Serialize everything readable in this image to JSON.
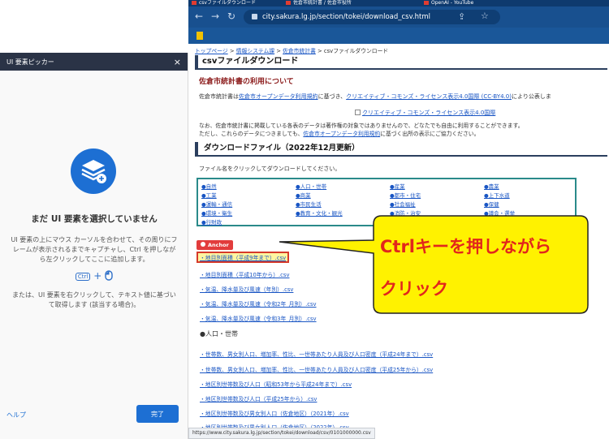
{
  "picker": {
    "title": "UI 要素ピッカー",
    "close": "×",
    "heading": "まだ UI 要素を選択していません",
    "description": "UI 要素の上にマウス カーソルを合わせて、その周りにフレームが表示されるまでキャプチャし、Ctrl を押しながら左クリックしてここに追加します。",
    "ctrl_key": "Ctrl",
    "plus": "+",
    "alt_description": "または、UI 要素を右クリックして、テキスト値に基づいて取得します (該当する場合)。",
    "help_label": "ヘルプ",
    "done_label": "完了"
  },
  "browser": {
    "tabs": [
      "csvファイルダウンロード",
      "佐倉市統計書 / 佐倉市役所",
      "OpenAI - YouTube"
    ],
    "url": "city.sakura.lg.jp/section/tokei/download_csv.html",
    "status_url": "https://www.city.sakura.lg.jp/section/tokei/download/csv/0101000000.csv"
  },
  "page": {
    "breadcrumb": [
      "トップページ",
      "情報システム課",
      "佐倉市統計書",
      "csvファイルダウンロード"
    ],
    "title": "csvファイルダウンロード",
    "section1_heading": "佐倉市統計書の利用について",
    "p1_prefix": "佐倉市統計書は",
    "p1_link": "佐倉市オープンデータ利用規約",
    "p1_mid": "に基づき、",
    "p1_link2": "クリエイティブ・コモンズ・ライセンス表示4.0国際 (CC-BY4.0)",
    "p1_suffix": "により公表しま",
    "cc_link": "クリエイティブ・コモンズ・ライセンス表示4.0国際",
    "p3_line1": "なお、佐倉市統計書に掲載している各表のデータは著作権の対象ではありませんので、どなたでも自由に利用することができます。",
    "p3_line2_prefix": "ただし、これらのデータにつきましても、",
    "p3_line2_link": "佐倉市オープンデータ利用規約",
    "p3_line2_suffix": "に基づく出所の表示にご協力ください。",
    "section2_heading": "ダウンロードファイル（2022年12月更新）",
    "p4": "ファイル名をクリックしてダウンロードしてください。",
    "categories": [
      "●自然",
      "●人口・世帯",
      "●産業",
      "●農業",
      "●工業",
      "●商業",
      "●都市・住宅",
      "●上下水道",
      "●運輸・通信",
      "●市民生活",
      "●社会福祉",
      "●保健",
      "●環境・衛生",
      "●教育・文化・観光",
      "●消防・治安",
      "●議会・選挙",
      "●行財政"
    ],
    "anchor_label": "Anchor",
    "files": [
      "・地目別面積（平成9年まで）.csv",
      "・地目別面積（平成10年から）.csv",
      "・気温、降水量及び風速（年別）.csv",
      "・気温、降水量及び風速（令和2年_月別）.csv",
      "・気温、降水量及び風速（令和3年_月別）.csv"
    ],
    "population_heading": "●人口・世帯",
    "pop_files": [
      "・世帯数、男女別人口、増加率、性比、一世帯あたり人員及び人口密度（平成24年まで）.csv",
      "・世帯数、男女別人口、増加率、性比、一世帯あたり人員及び人口密度（平成25年から）.csv",
      "・地区別世帯数及び人口（昭和53年から平成24年まで）.csv",
      "・地区別世帯数及び人口（平成25年から）.csv",
      "・地区別世帯数及び男女別人口（佐倉地区）（2021年）.csv",
      "・地区別世帯数及び男女別人口（佐倉地区）（2022年）.csv"
    ]
  },
  "callout": {
    "line1": "Ctrlキーを押しながら",
    "line2": "クリック",
    "fill_color": "#fff200",
    "text_color": "#e2261c"
  }
}
